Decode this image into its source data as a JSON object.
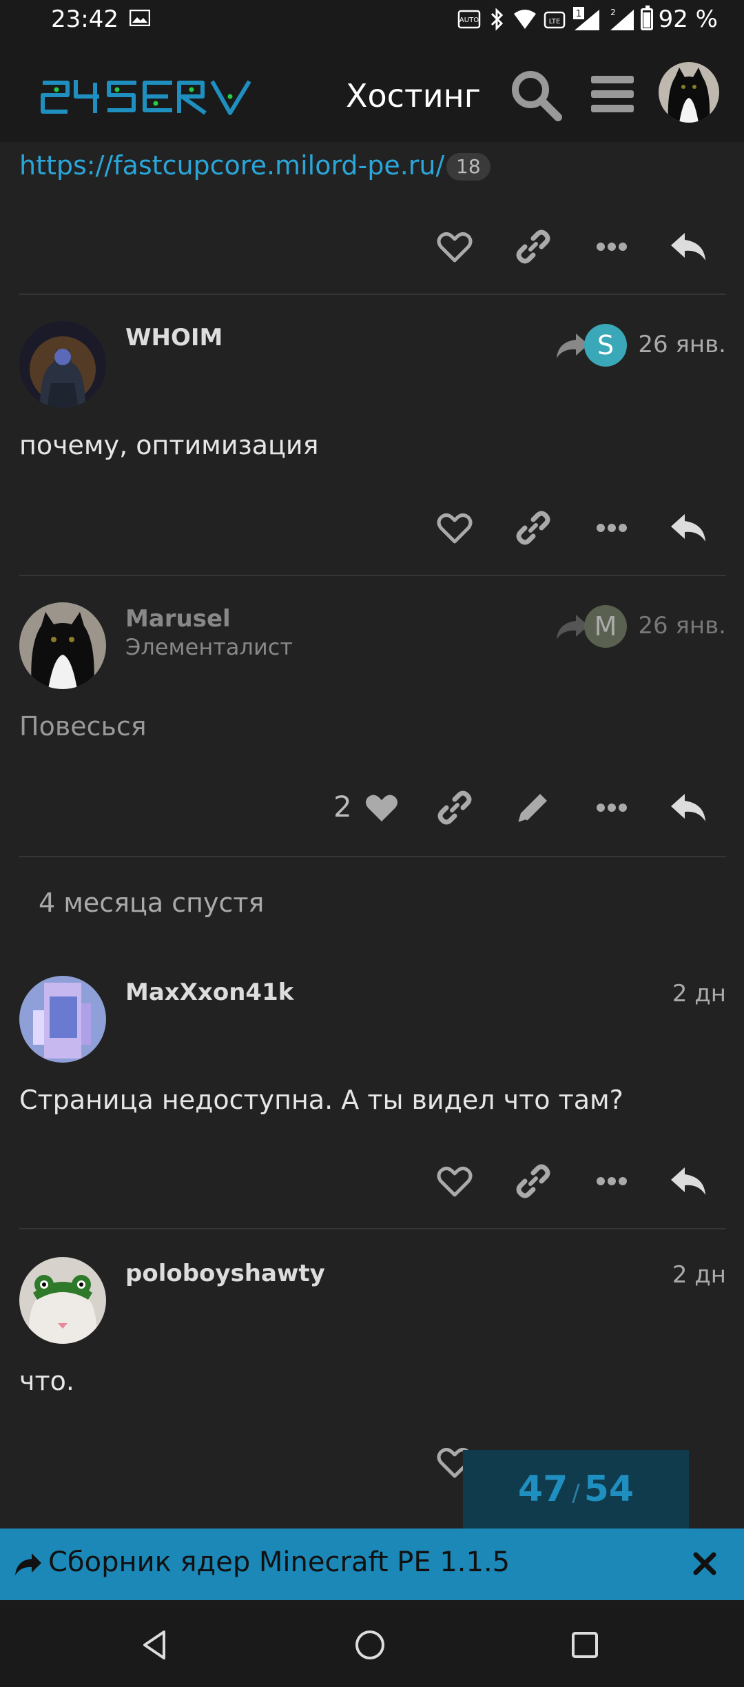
{
  "status_bar": {
    "time": "23:42",
    "battery": "92 %"
  },
  "header": {
    "logo_text": "24SERV",
    "title": "Хостинг"
  },
  "top_post": {
    "link": "https://fastcupcore.milord-pe.ru/",
    "clicks": "18"
  },
  "posts": [
    {
      "username": "WHOIM",
      "reply_to_initial": "S",
      "date": "26 янв.",
      "text": "почему, оптимизация"
    },
    {
      "username": "Marusel",
      "user_title": "Элементалист",
      "reply_to_initial": "M",
      "date": "26 янв.",
      "text": "Повесься",
      "likes": "2"
    },
    {
      "username": "MaxXxon41k",
      "date": "2 дн",
      "text": "Страница недоступна. А ты видел что там?"
    },
    {
      "username": "poloboyshawty",
      "date": "2 дн",
      "text": "что."
    }
  ],
  "time_gap": "4 месяца спустя",
  "progress": {
    "current": "47",
    "total": "54"
  },
  "banner": {
    "topic_title": "Сборник ядер Minecraft PE 1.1.5"
  },
  "colors": {
    "accent": "#2aa6d8",
    "banner": "#1c88b8",
    "background": "#222222"
  }
}
